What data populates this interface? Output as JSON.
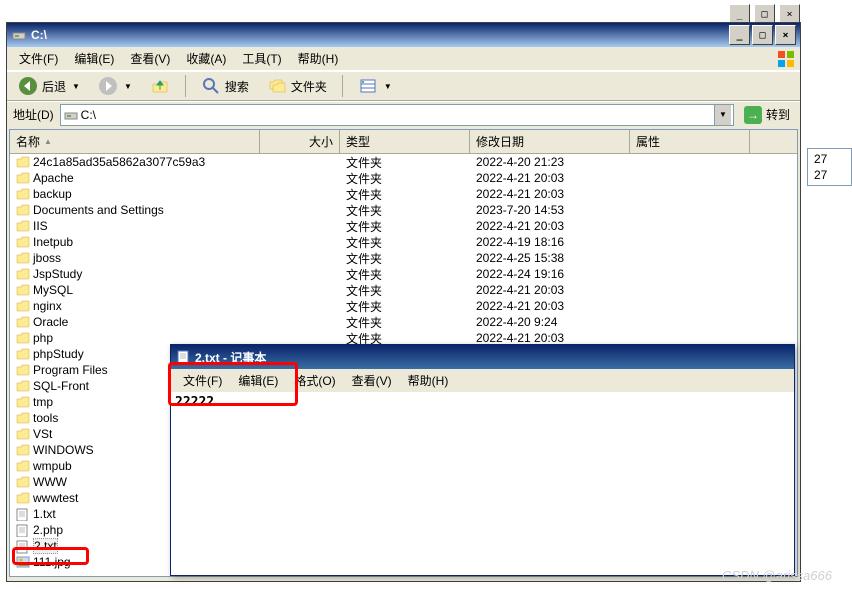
{
  "explorer": {
    "title": "C:\\",
    "menus": {
      "file": "文件(F)",
      "edit": "编辑(E)",
      "view": "查看(V)",
      "favorites": "收藏(A)",
      "tools": "工具(T)",
      "help": "帮助(H)"
    },
    "toolbar": {
      "back": "后退",
      "search": "搜索",
      "folders": "文件夹"
    },
    "address": {
      "label": "地址(D)",
      "value": "C:\\",
      "go": "转到"
    },
    "columns": {
      "name": "名称",
      "size": "大小",
      "type": "类型",
      "date": "修改日期",
      "attr": "属性"
    }
  },
  "files": [
    {
      "icon": "folder",
      "name": "24c1a85ad35a5862a3077c59a3",
      "size": "",
      "type": "文件夹",
      "date": "2022-4-20 21:23",
      "attr": ""
    },
    {
      "icon": "folder",
      "name": "Apache",
      "size": "",
      "type": "文件夹",
      "date": "2022-4-21 20:03",
      "attr": ""
    },
    {
      "icon": "folder",
      "name": "backup",
      "size": "",
      "type": "文件夹",
      "date": "2022-4-21 20:03",
      "attr": ""
    },
    {
      "icon": "folder",
      "name": "Documents and Settings",
      "size": "",
      "type": "文件夹",
      "date": "2023-7-20 14:53",
      "attr": ""
    },
    {
      "icon": "folder",
      "name": "IIS",
      "size": "",
      "type": "文件夹",
      "date": "2022-4-21 20:03",
      "attr": ""
    },
    {
      "icon": "folder",
      "name": "Inetpub",
      "size": "",
      "type": "文件夹",
      "date": "2022-4-19 18:16",
      "attr": ""
    },
    {
      "icon": "folder",
      "name": "jboss",
      "size": "",
      "type": "文件夹",
      "date": "2022-4-25 15:38",
      "attr": ""
    },
    {
      "icon": "folder",
      "name": "JspStudy",
      "size": "",
      "type": "文件夹",
      "date": "2022-4-24 19:16",
      "attr": ""
    },
    {
      "icon": "folder",
      "name": "MySQL",
      "size": "",
      "type": "文件夹",
      "date": "2022-4-21 20:03",
      "attr": ""
    },
    {
      "icon": "folder",
      "name": "nginx",
      "size": "",
      "type": "文件夹",
      "date": "2022-4-21 20:03",
      "attr": ""
    },
    {
      "icon": "folder",
      "name": "Oracle",
      "size": "",
      "type": "文件夹",
      "date": "2022-4-20 9:24",
      "attr": ""
    },
    {
      "icon": "folder",
      "name": "php",
      "size": "",
      "type": "文件夹",
      "date": "2022-4-21 20:03",
      "attr": ""
    },
    {
      "icon": "folder",
      "name": "phpStudy",
      "size": "",
      "type": "",
      "date": "",
      "attr": ""
    },
    {
      "icon": "folder",
      "name": "Program Files",
      "size": "",
      "type": "",
      "date": "",
      "attr": ""
    },
    {
      "icon": "folder",
      "name": "SQL-Front",
      "size": "",
      "type": "",
      "date": "",
      "attr": ""
    },
    {
      "icon": "folder",
      "name": "tmp",
      "size": "",
      "type": "",
      "date": "",
      "attr": ""
    },
    {
      "icon": "folder",
      "name": "tools",
      "size": "",
      "type": "",
      "date": "",
      "attr": ""
    },
    {
      "icon": "folder",
      "name": "VSt",
      "size": "",
      "type": "",
      "date": "",
      "attr": ""
    },
    {
      "icon": "folder",
      "name": "WINDOWS",
      "size": "",
      "type": "",
      "date": "",
      "attr": ""
    },
    {
      "icon": "folder",
      "name": "wmpub",
      "size": "",
      "type": "",
      "date": "",
      "attr": ""
    },
    {
      "icon": "folder",
      "name": "WWW",
      "size": "",
      "type": "",
      "date": "",
      "attr": ""
    },
    {
      "icon": "folder",
      "name": "wwwtest",
      "size": "",
      "type": "",
      "date": "",
      "attr": ""
    },
    {
      "icon": "txt",
      "name": "1.txt",
      "size": "",
      "type": "",
      "date": "",
      "attr": ""
    },
    {
      "icon": "txt",
      "name": "2.php",
      "size": "",
      "type": "",
      "date": "",
      "attr": ""
    },
    {
      "icon": "txt",
      "name": "2.txt",
      "size": "",
      "type": "",
      "date": "",
      "attr": "",
      "selected": true
    },
    {
      "icon": "img",
      "name": "111.jpg",
      "size": "",
      "type": "",
      "date": "",
      "attr": ""
    }
  ],
  "notepad": {
    "title": "2.txt - 记事本",
    "menus": {
      "file": "文件(F)",
      "edit": "编辑(E)",
      "format": "格式(O)",
      "view": "查看(V)",
      "help": "帮助(H)"
    },
    "content": "22222"
  },
  "right_strip": [
    "27",
    "27"
  ],
  "watermark": "CSDN @arissa666",
  "icons": {
    "min": "_",
    "max": "□",
    "close": "×",
    "back_arrow": "◀",
    "fwd_arrow": "▶",
    "up_arrow": "▲",
    "down": "▼",
    "go": "→"
  }
}
